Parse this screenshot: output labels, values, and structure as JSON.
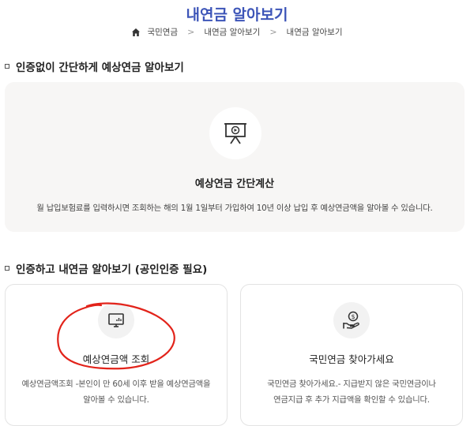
{
  "page": {
    "title": "내연금 알아보기"
  },
  "breadcrumb": {
    "items": [
      "국민연금",
      "내연금 알아보기",
      "내연금 알아보기"
    ],
    "separator": ">"
  },
  "section1": {
    "heading": "인증없이 간단하게 예상연금 알아보기",
    "card": {
      "icon": "presentation-board-icon",
      "title": "예상연금 간단계산",
      "description": "월 납입보험료를 입력하시면 조회하는 해의 1월 1일부터 가입하여 10년 이상 납입 후 예상연금액을 알아볼 수 있습니다."
    }
  },
  "section2": {
    "heading": "인증하고 내연금 알아보기 (공인인증 필요)",
    "cards": [
      {
        "icon": "monitor-chart-icon",
        "title": "예상연금액 조회",
        "description_line1": "예상연금액조회 -본인이 만 60세 이후 받을 예상연금액을",
        "description_line2": "알아볼 수 있습니다."
      },
      {
        "icon": "hand-coin-icon",
        "title": "국민연금 찾아가세요",
        "description_line1": "국민연금 찾아가세요.- 지급받지 않은 국민연금이나",
        "description_line2": "연금지급 후 추가 지급액을 확인할 수 있습니다."
      }
    ]
  },
  "colors": {
    "title": "#3d55b8",
    "annotation": "#e2231a",
    "card_bg": "#f7f6f5"
  }
}
